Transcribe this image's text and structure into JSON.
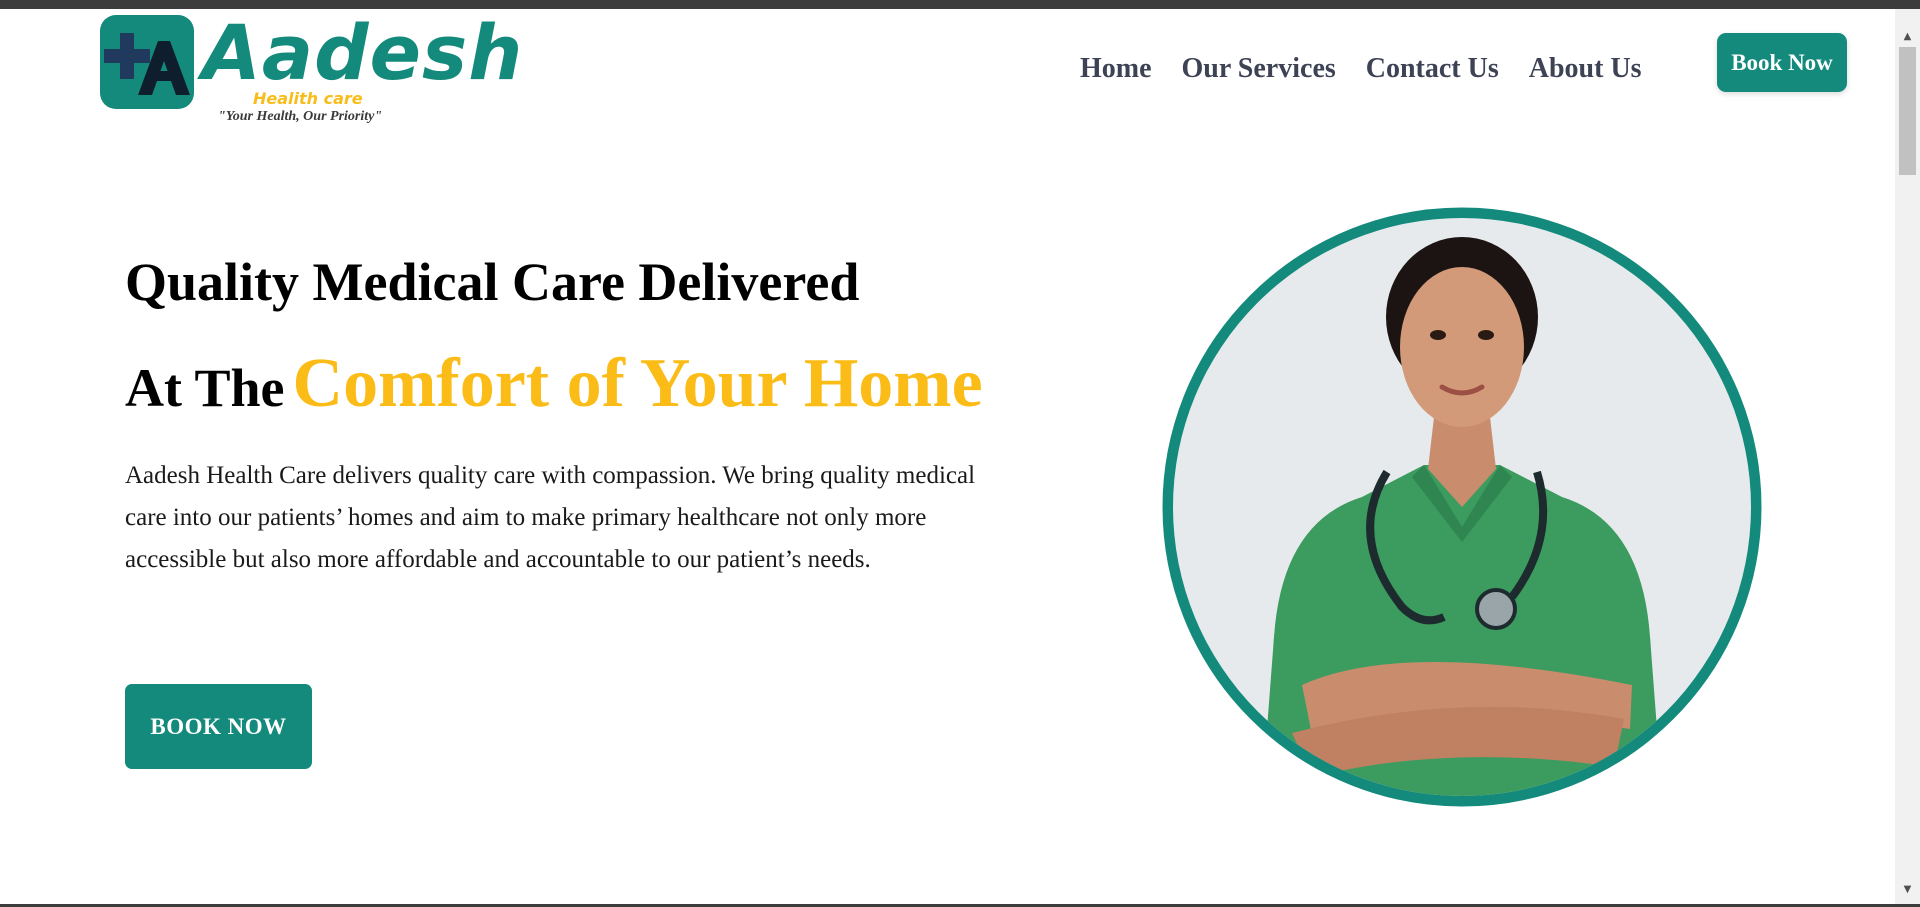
{
  "brand": {
    "name": "Aadesh",
    "subtitle": "Healith care",
    "tagline": "\"Your Health, Our Priority\""
  },
  "nav": {
    "items": [
      {
        "label": "Home"
      },
      {
        "label": "Our Services"
      },
      {
        "label": "Contact Us"
      },
      {
        "label": "About Us"
      }
    ],
    "book_button": "Book Now"
  },
  "hero": {
    "line1": "Quality Medical Care Delivered",
    "line2_plain": "At The",
    "line2_accent": "Comfort of Your Home",
    "description": "Aadesh Health Care delivers quality care with compassion. We bring quality medical care into our patients’ homes and aim to make primary healthcare not only more accessible but also more affordable and accountable to our patient’s needs.",
    "cta": "BOOK NOW"
  },
  "theme": {
    "primary": "#138a7c",
    "accent": "#fbbc17",
    "nav_text": "#3d4355"
  },
  "icons": {
    "logo": "medical-cross-a-icon",
    "scroll_up": "triangle-up-icon",
    "scroll_down": "triangle-down-icon"
  }
}
